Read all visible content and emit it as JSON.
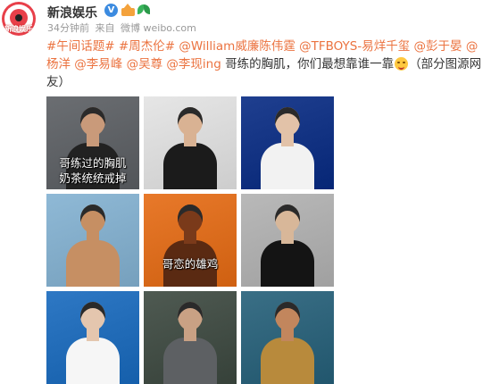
{
  "post": {
    "author": "新浪娱乐",
    "avatar_label": "新浪娱乐",
    "time": "34分钟前",
    "source_prefix": "来自",
    "source": "微博 weibo.com",
    "content": [
      {
        "type": "link",
        "text": "#午间话题#"
      },
      {
        "type": "text",
        "text": " "
      },
      {
        "type": "link",
        "text": "#周杰伦#"
      },
      {
        "type": "text",
        "text": " "
      },
      {
        "type": "mention",
        "text": "@William威廉陈伟霆"
      },
      {
        "type": "text",
        "text": " "
      },
      {
        "type": "mention",
        "text": "@TFBOYS-易烊千玺"
      },
      {
        "type": "text",
        "text": " "
      },
      {
        "type": "mention",
        "text": "@彭于晏"
      },
      {
        "type": "text",
        "text": " "
      },
      {
        "type": "mention",
        "text": "@杨洋"
      },
      {
        "type": "text",
        "text": " "
      },
      {
        "type": "mention",
        "text": "@李易峰"
      },
      {
        "type": "text",
        "text": " "
      },
      {
        "type": "mention",
        "text": "@吴尊"
      },
      {
        "type": "text",
        "text": " "
      },
      {
        "type": "mention",
        "text": "@李现ing"
      },
      {
        "type": "text",
        "text": " 哥练的胸肌，你们最想靠谁一靠"
      },
      {
        "type": "emoji",
        "text": ""
      },
      {
        "type": "text",
        "text": "（部分图源网友）"
      }
    ],
    "photos": [
      {
        "caption": "哥练过的胸肌\n奶茶统统戒掉",
        "bg": "#6b6e72",
        "skin": "#c99a7a",
        "shirt": "#222222"
      },
      {
        "caption": "",
        "bg": "#e6e6e6",
        "skin": "#d9b293",
        "shirt": "#1b1b1b"
      },
      {
        "caption": "",
        "bg": "#1f3f8f",
        "skin": "#e2c2a8",
        "shirt": "#f2f2f2"
      },
      {
        "caption": "",
        "bg": "#8fb9d6",
        "skin": "#c68f63",
        "shirt": "#c68f63"
      },
      {
        "caption": "哥恋的雄鸡",
        "bg": "#e8792a",
        "skin": "#7a3a1a",
        "shirt": "#5a2a12"
      },
      {
        "caption": "",
        "bg": "#b9b9b9",
        "skin": "#d8b799",
        "shirt": "#141414"
      },
      {
        "caption": "",
        "bg": "#2e78c4",
        "skin": "#e4c6ae",
        "shirt": "#f6f6f6"
      },
      {
        "caption": "",
        "bg": "#4f5a52",
        "skin": "#c9a184",
        "shirt": "#5d6063"
      },
      {
        "caption": "",
        "bg": "#3a6f86",
        "skin": "#c2865d",
        "shirt": "#b88a3c"
      }
    ]
  }
}
